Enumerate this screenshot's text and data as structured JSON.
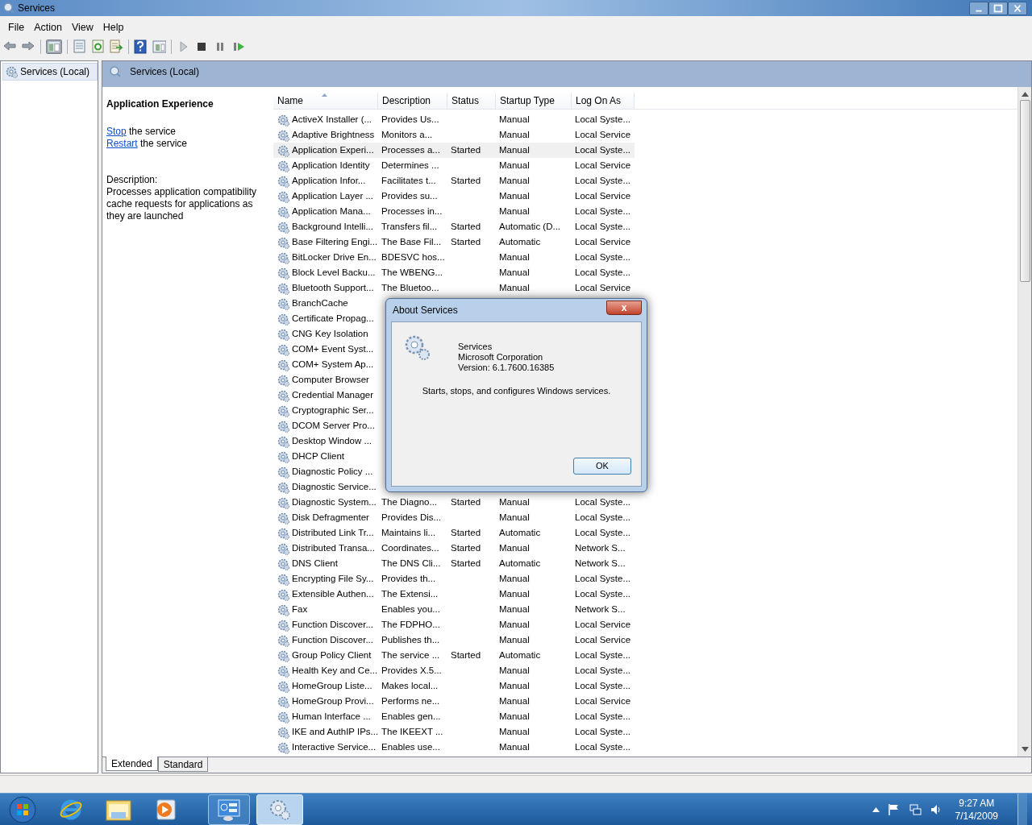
{
  "window": {
    "title": "Services"
  },
  "menu": [
    "File",
    "Action",
    "View",
    "Help"
  ],
  "tree": {
    "items": [
      {
        "label": "Services (Local)",
        "selected": true
      }
    ]
  },
  "pane_header": {
    "title": "Services (Local)"
  },
  "details": {
    "title": "Application Experience",
    "actions": [
      {
        "link": "Stop",
        "text": " the service"
      },
      {
        "link": "Restart",
        "text": " the service"
      }
    ],
    "description_label": "Description:",
    "description": "Processes application compatibility cache requests for applications as they are launched"
  },
  "table": {
    "columns": [
      "Name",
      "Description",
      "Status",
      "Startup Type",
      "Log On As"
    ],
    "rows": [
      {
        "name": "ActiveX Installer (...",
        "description": "Provides Us...",
        "status": "",
        "startup": "Manual",
        "logon": "Local Syste...",
        "selected": false
      },
      {
        "name": "Adaptive Brightness",
        "description": "Monitors a...",
        "status": "",
        "startup": "Manual",
        "logon": "Local Service",
        "selected": false
      },
      {
        "name": "Application Experi...",
        "description": "Processes a...",
        "status": "Started",
        "startup": "Manual",
        "logon": "Local Syste...",
        "selected": true
      },
      {
        "name": "Application Identity",
        "description": "Determines ...",
        "status": "",
        "startup": "Manual",
        "logon": "Local Service",
        "selected": false
      },
      {
        "name": "Application Infor...",
        "description": "Facilitates t...",
        "status": "Started",
        "startup": "Manual",
        "logon": "Local Syste...",
        "selected": false
      },
      {
        "name": "Application Layer ...",
        "description": "Provides su...",
        "status": "",
        "startup": "Manual",
        "logon": "Local Service",
        "selected": false
      },
      {
        "name": "Application Mana...",
        "description": "Processes in...",
        "status": "",
        "startup": "Manual",
        "logon": "Local Syste...",
        "selected": false
      },
      {
        "name": "Background Intelli...",
        "description": "Transfers fil...",
        "status": "Started",
        "startup": "Automatic (D...",
        "logon": "Local Syste...",
        "selected": false
      },
      {
        "name": "Base Filtering Engi...",
        "description": "The Base Fil...",
        "status": "Started",
        "startup": "Automatic",
        "logon": "Local Service",
        "selected": false
      },
      {
        "name": "BitLocker Drive En...",
        "description": "BDESVC hos...",
        "status": "",
        "startup": "Manual",
        "logon": "Local Syste...",
        "selected": false
      },
      {
        "name": "Block Level Backu...",
        "description": "The WBENG...",
        "status": "",
        "startup": "Manual",
        "logon": "Local Syste...",
        "selected": false
      },
      {
        "name": "Bluetooth Support...",
        "description": "The Bluetoo...",
        "status": "",
        "startup": "Manual",
        "logon": "Local Service",
        "selected": false
      },
      {
        "name": "BranchCache",
        "selected": false
      },
      {
        "name": "Certificate Propag...",
        "selected": false
      },
      {
        "name": "CNG Key Isolation",
        "selected": false
      },
      {
        "name": "COM+ Event Syst...",
        "selected": false
      },
      {
        "name": "COM+ System Ap...",
        "selected": false
      },
      {
        "name": "Computer Browser",
        "selected": false
      },
      {
        "name": "Credential Manager",
        "selected": false
      },
      {
        "name": "Cryptographic Ser...",
        "selected": false
      },
      {
        "name": "DCOM Server Pro...",
        "selected": false
      },
      {
        "name": "Desktop Window ...",
        "selected": false
      },
      {
        "name": "DHCP Client",
        "selected": false
      },
      {
        "name": "Diagnostic Policy ...",
        "selected": false
      },
      {
        "name": "Diagnostic Service...",
        "selected": false
      },
      {
        "name": "Diagnostic System...",
        "description": "The Diagno...",
        "status": "Started",
        "startup": "Manual",
        "logon": "Local Syste...",
        "selected": false
      },
      {
        "name": "Disk Defragmenter",
        "description": "Provides Dis...",
        "status": "",
        "startup": "Manual",
        "logon": "Local Syste...",
        "selected": false
      },
      {
        "name": "Distributed Link Tr...",
        "description": "Maintains li...",
        "status": "Started",
        "startup": "Automatic",
        "logon": "Local Syste...",
        "selected": false
      },
      {
        "name": "Distributed Transa...",
        "description": "Coordinates...",
        "status": "Started",
        "startup": "Manual",
        "logon": "Network S...",
        "selected": false
      },
      {
        "name": "DNS Client",
        "description": "The DNS Cli...",
        "status": "Started",
        "startup": "Automatic",
        "logon": "Network S...",
        "selected": false
      },
      {
        "name": "Encrypting File Sy...",
        "description": "Provides th...",
        "status": "",
        "startup": "Manual",
        "logon": "Local Syste...",
        "selected": false
      },
      {
        "name": "Extensible Authen...",
        "description": "The Extensi...",
        "status": "",
        "startup": "Manual",
        "logon": "Local Syste...",
        "selected": false
      },
      {
        "name": "Fax",
        "description": "Enables you...",
        "status": "",
        "startup": "Manual",
        "logon": "Network S...",
        "selected": false
      },
      {
        "name": "Function Discover...",
        "description": "The FDPHO...",
        "status": "",
        "startup": "Manual",
        "logon": "Local Service",
        "selected": false
      },
      {
        "name": "Function Discover...",
        "description": "Publishes th...",
        "status": "",
        "startup": "Manual",
        "logon": "Local Service",
        "selected": false
      },
      {
        "name": "Group Policy Client",
        "description": "The service ...",
        "status": "Started",
        "startup": "Automatic",
        "logon": "Local Syste...",
        "selected": false
      },
      {
        "name": "Health Key and Ce...",
        "description": "Provides X.5...",
        "status": "",
        "startup": "Manual",
        "logon": "Local Syste...",
        "selected": false
      },
      {
        "name": "HomeGroup Liste...",
        "description": "Makes local...",
        "status": "",
        "startup": "Manual",
        "logon": "Local Syste...",
        "selected": false
      },
      {
        "name": "HomeGroup Provi...",
        "description": "Performs ne...",
        "status": "",
        "startup": "Manual",
        "logon": "Local Service",
        "selected": false
      },
      {
        "name": "Human Interface ...",
        "description": "Enables gen...",
        "status": "",
        "startup": "Manual",
        "logon": "Local Syste...",
        "selected": false
      },
      {
        "name": "IKE and AuthIP IPs...",
        "description": "The IKEEXT ...",
        "status": "",
        "startup": "Manual",
        "logon": "Local Syste...",
        "selected": false
      },
      {
        "name": "Interactive Service...",
        "description": "Enables use...",
        "status": "",
        "startup": "Manual",
        "logon": "Local Syste...",
        "selected": false
      }
    ]
  },
  "view_tabs": [
    {
      "label": "Extended",
      "selected": true
    },
    {
      "label": "Standard",
      "selected": false
    }
  ],
  "dialog": {
    "title": "About Services",
    "close": "x",
    "product": "Services",
    "company": "Microsoft Corporation",
    "version": "Version: 6.1.7600.16385",
    "description": "Starts, stops, and configures Windows services.",
    "button": "OK"
  },
  "taskbar": {
    "clock_time": "9:27 AM",
    "clock_date": "7/14/2009"
  }
}
